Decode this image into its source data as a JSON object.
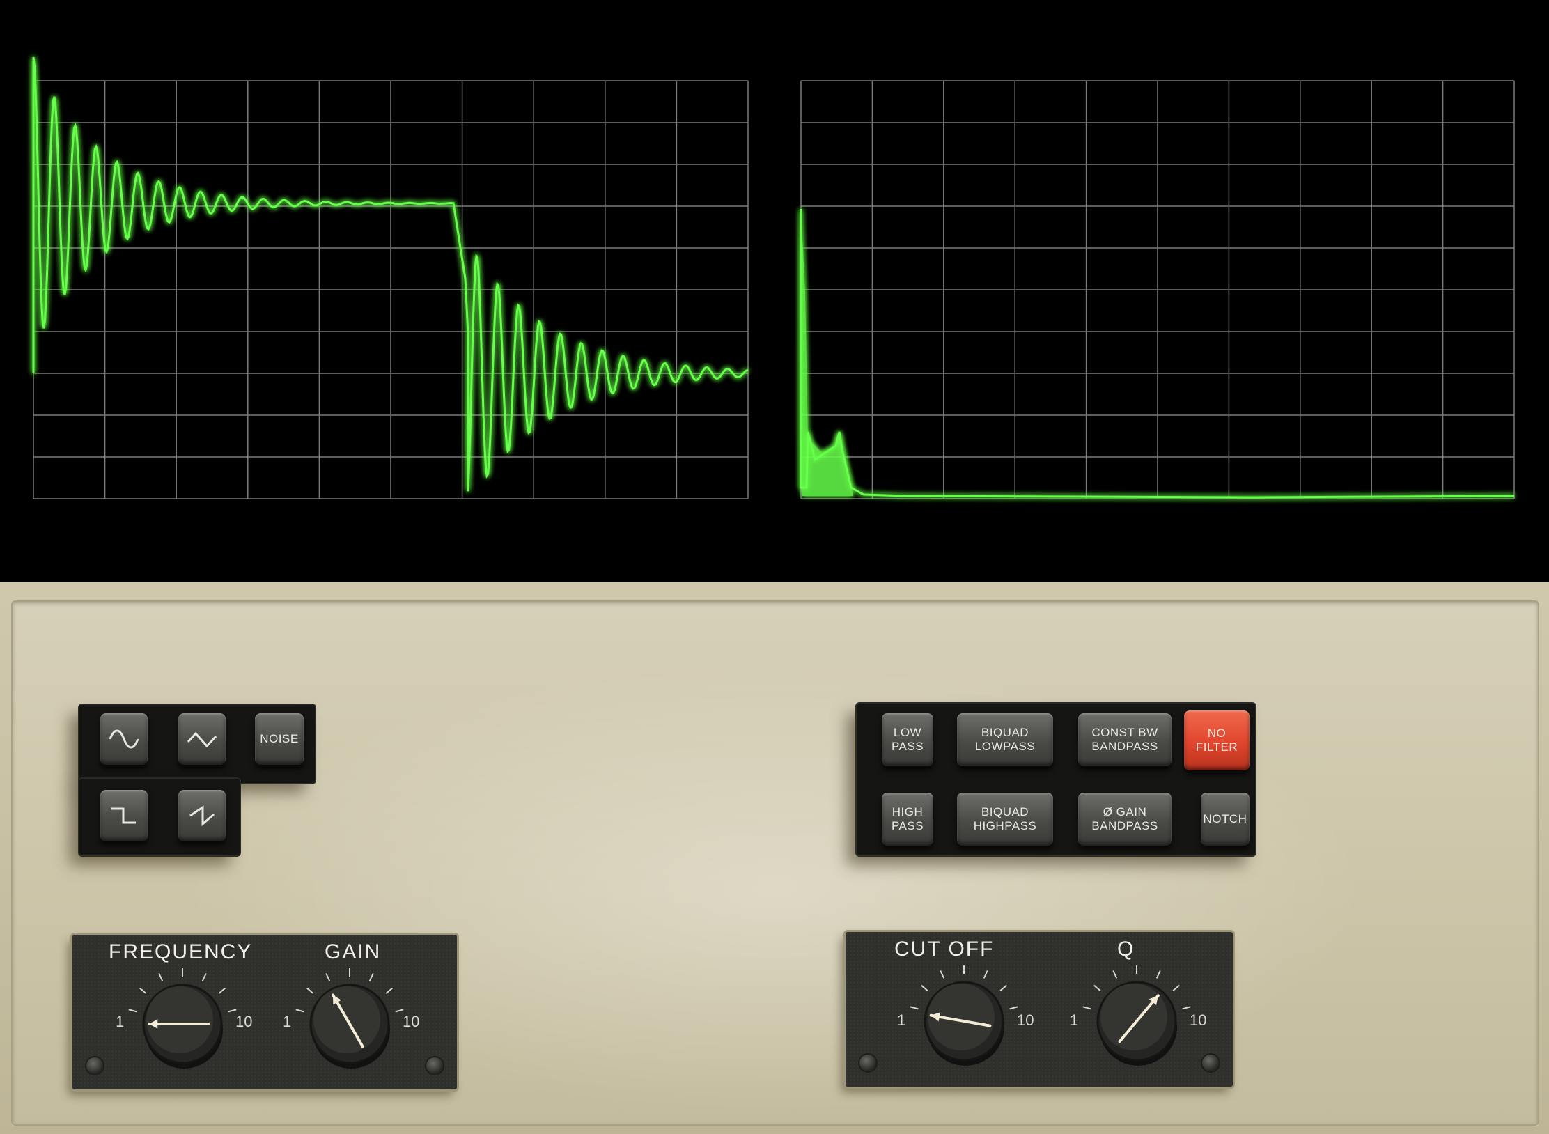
{
  "scope": {
    "trace_color": "#66ff4a",
    "grid_color": "#7a7a7a",
    "left_screen": {
      "content": "time-domain waveform (square wave with ringing)"
    },
    "right_screen": {
      "content": "frequency spectrum"
    }
  },
  "waveform_buttons": {
    "sine": {
      "icon": "sine-wave-icon"
    },
    "triangle": {
      "icon": "triangle-wave-icon"
    },
    "noise": {
      "label": "NOISE"
    },
    "square": {
      "icon": "square-wave-icon"
    },
    "sawtooth": {
      "icon": "sawtooth-wave-icon"
    }
  },
  "filter_buttons": {
    "low_pass": "LOW\nPASS",
    "biquad_lowpass": "BIQUAD\nLOWPASS",
    "const_bw_bandpass": "CONST BW\nBANDPASS",
    "no_filter": "NO\nFILTER",
    "high_pass": "HIGH\nPASS",
    "biquad_highpass": "BIQUAD\nHIGHPASS",
    "zero_gain_bandpass": "Ø GAIN\nBANDPASS",
    "notch": "NOTCH",
    "active": "no_filter",
    "active_color": "#e0452c"
  },
  "knobs": {
    "frequency": {
      "label": "FREQUENCY",
      "min": "1",
      "max": "10",
      "value": 1
    },
    "gain": {
      "label": "GAIN",
      "min": "1",
      "max": "10",
      "value": 4
    },
    "cutoff": {
      "label": "CUT OFF",
      "min": "1",
      "max": "10",
      "value": 1.5
    },
    "q": {
      "label": "Q",
      "min": "1",
      "max": "10",
      "value": 7.5
    }
  }
}
